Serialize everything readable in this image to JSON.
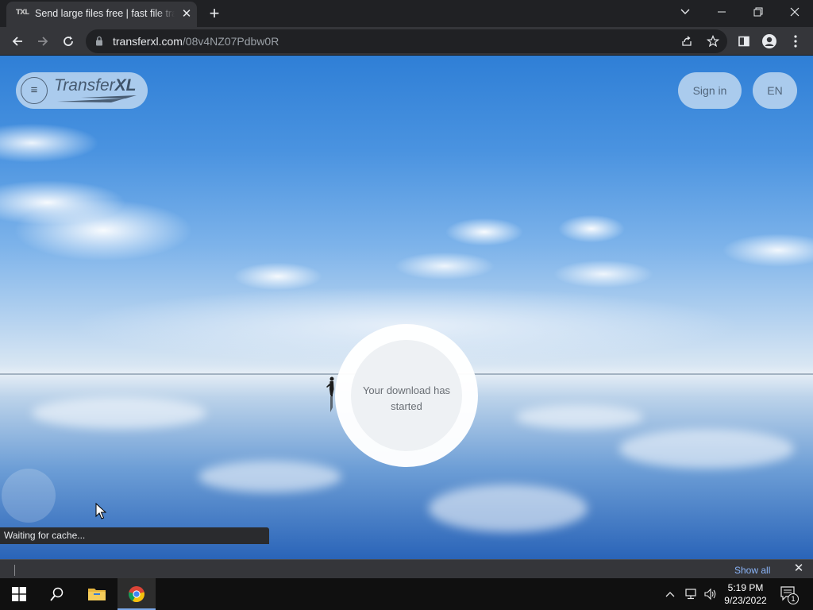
{
  "browser": {
    "tab_title": "Send large files free | fast file transfer",
    "tab_favicon": "TXL",
    "new_tab_label": "+",
    "url_host": "transferxl.com",
    "url_path": "/08v4NZ07Pdbw0R"
  },
  "site": {
    "logo_prefix": "Transfer",
    "logo_suffix": "XL",
    "menu_icon": "≡",
    "sign_in_label": "Sign in",
    "language_label": "EN",
    "download_status": "Your download has started"
  },
  "status_bar": {
    "text": "Waiting for cache..."
  },
  "download_shelf": {
    "show_all_label": "Show all"
  },
  "taskbar": {
    "time": "5:19 PM",
    "date": "9/23/2022",
    "notification_count": "1"
  },
  "colors": {
    "accent_link": "#8ab4f8",
    "pill_background": "#bed7f0",
    "browser_dark": "#202124"
  }
}
